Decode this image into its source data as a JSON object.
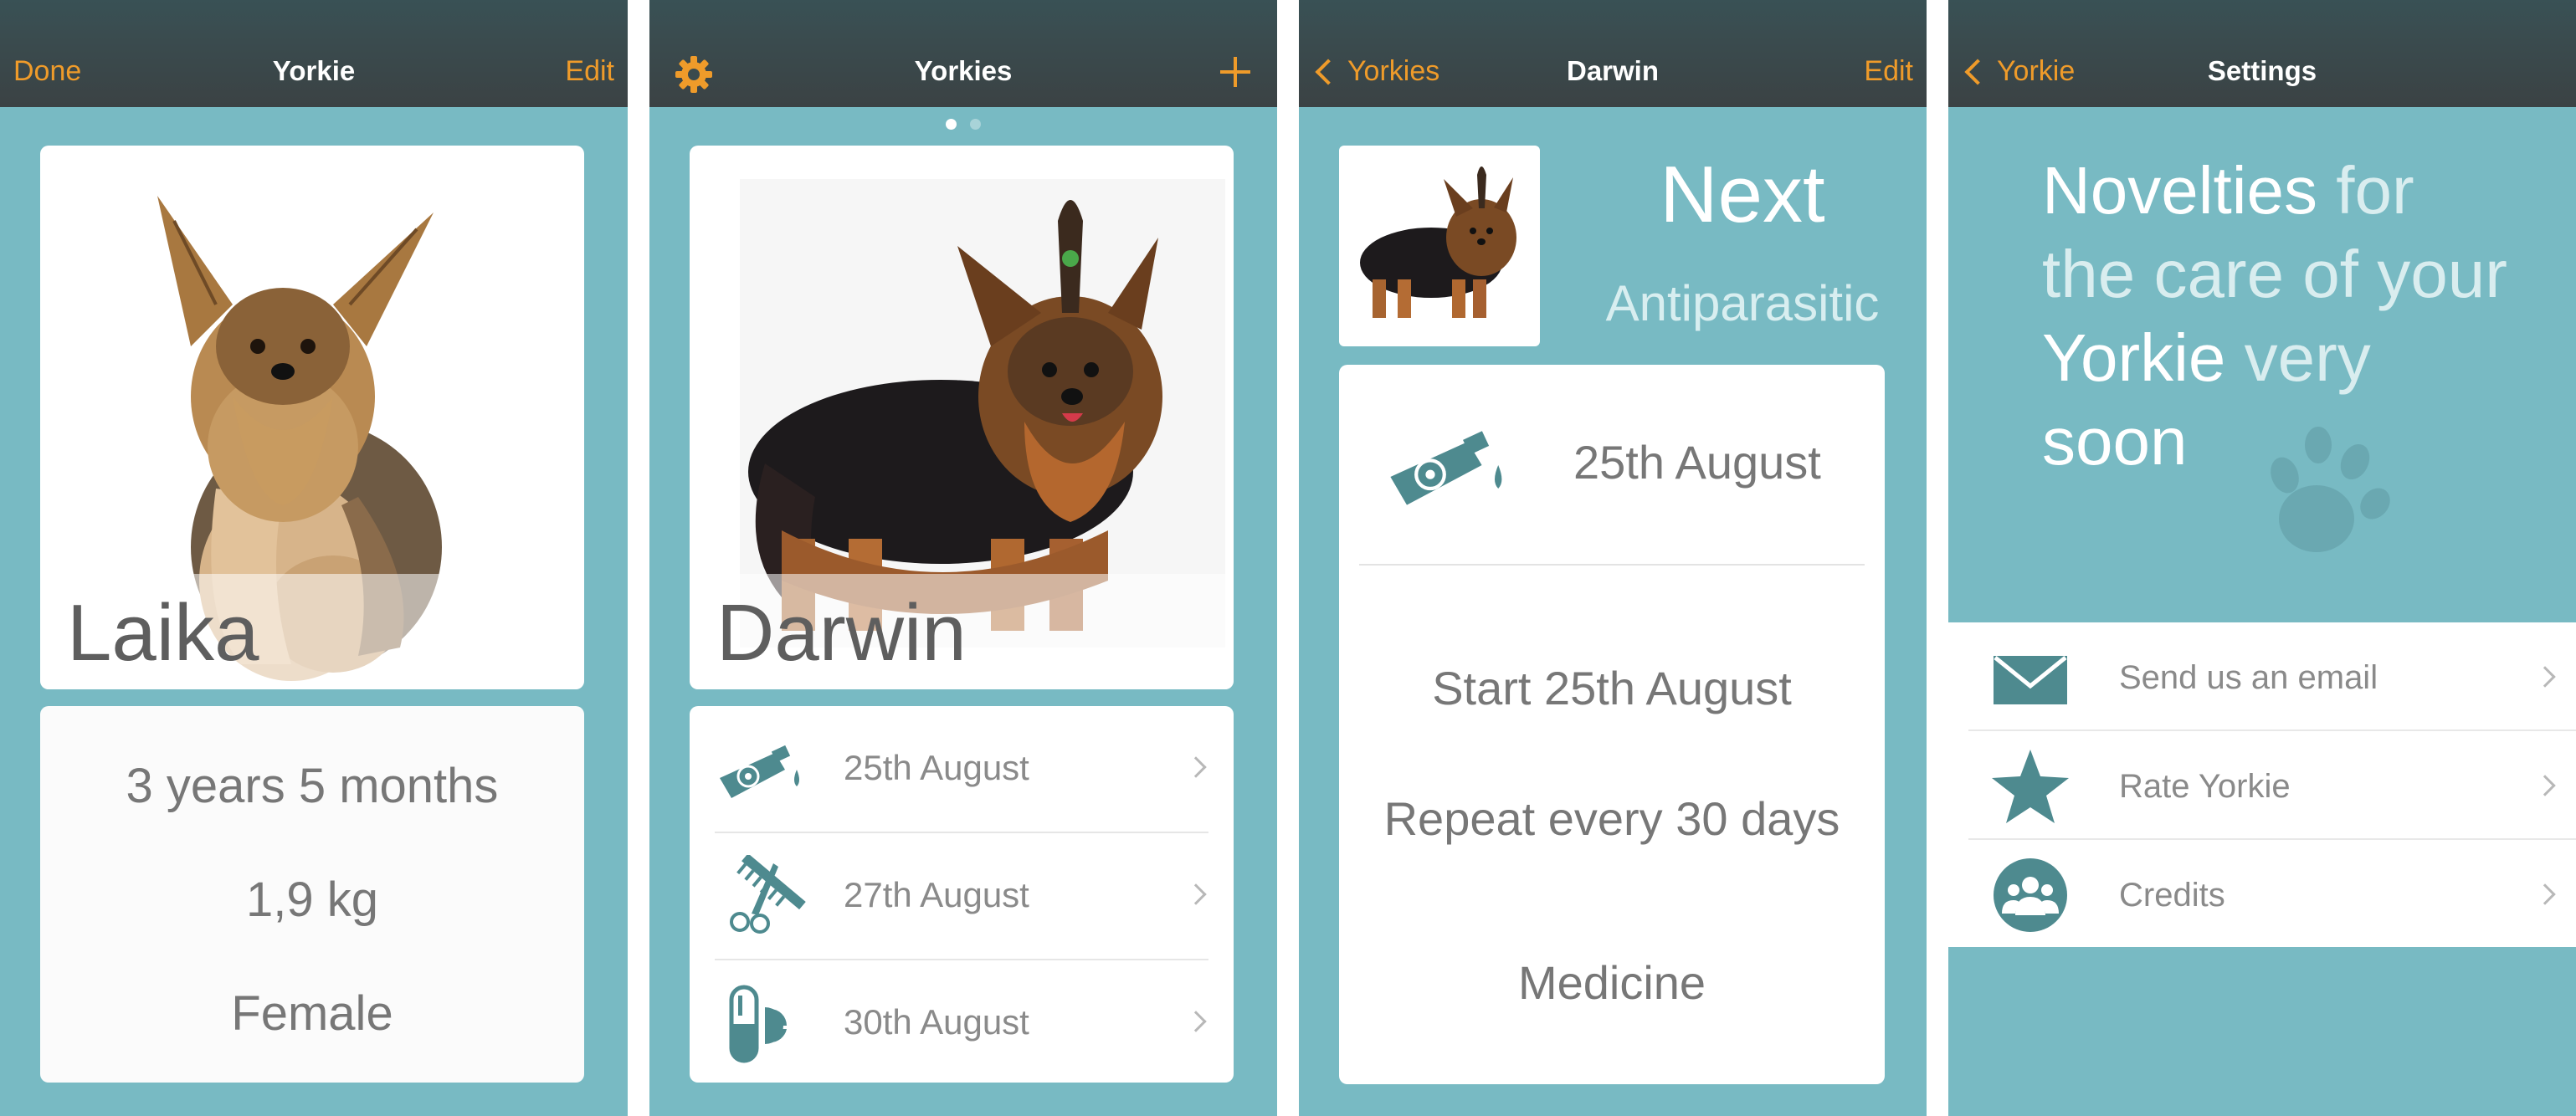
{
  "colors": {
    "accent": "#ef9b2a",
    "background": "#78bac3",
    "icon": "#4e8a8f",
    "navbar": "#3a4a4d"
  },
  "screen1": {
    "nav": {
      "left": "Done",
      "title": "Yorkie",
      "right": "Edit"
    },
    "dog_name": "Laika",
    "info": {
      "age": "3 years 5 months",
      "weight": "1,9 kg",
      "sex": "Female"
    }
  },
  "screen2": {
    "nav": {
      "left_icon": "gear-icon",
      "title": "Yorkies",
      "right_icon": "plus-icon"
    },
    "page_dots": {
      "count": 2,
      "active": 1
    },
    "dog_name": "Darwin",
    "events": [
      {
        "icon": "antiparasitic-icon",
        "label": "25th August"
      },
      {
        "icon": "grooming-icon",
        "label": "27th August"
      },
      {
        "icon": "pill-icon",
        "label": "30th August"
      }
    ]
  },
  "screen3": {
    "nav": {
      "back": "Yorkies",
      "title": "Darwin",
      "right": "Edit"
    },
    "next_title": "Next",
    "next_subtitle": "Antiparasitic",
    "date": "25th August",
    "start": "Start 25th August",
    "repeat": "Repeat every 30 days",
    "type": "Medicine"
  },
  "screen4": {
    "nav": {
      "back": "Yorkie",
      "title": "Settings"
    },
    "promo": {
      "w1": "Novelties",
      "w2": "for",
      "w3": "the care of your",
      "w4": "Yorkie",
      "w5": "very",
      "w6": "soon"
    },
    "items": [
      {
        "icon": "envelope-icon",
        "label": "Send us an email"
      },
      {
        "icon": "star-icon",
        "label": "Rate Yorkie"
      },
      {
        "icon": "credits-icon",
        "label": "Credits"
      }
    ]
  }
}
